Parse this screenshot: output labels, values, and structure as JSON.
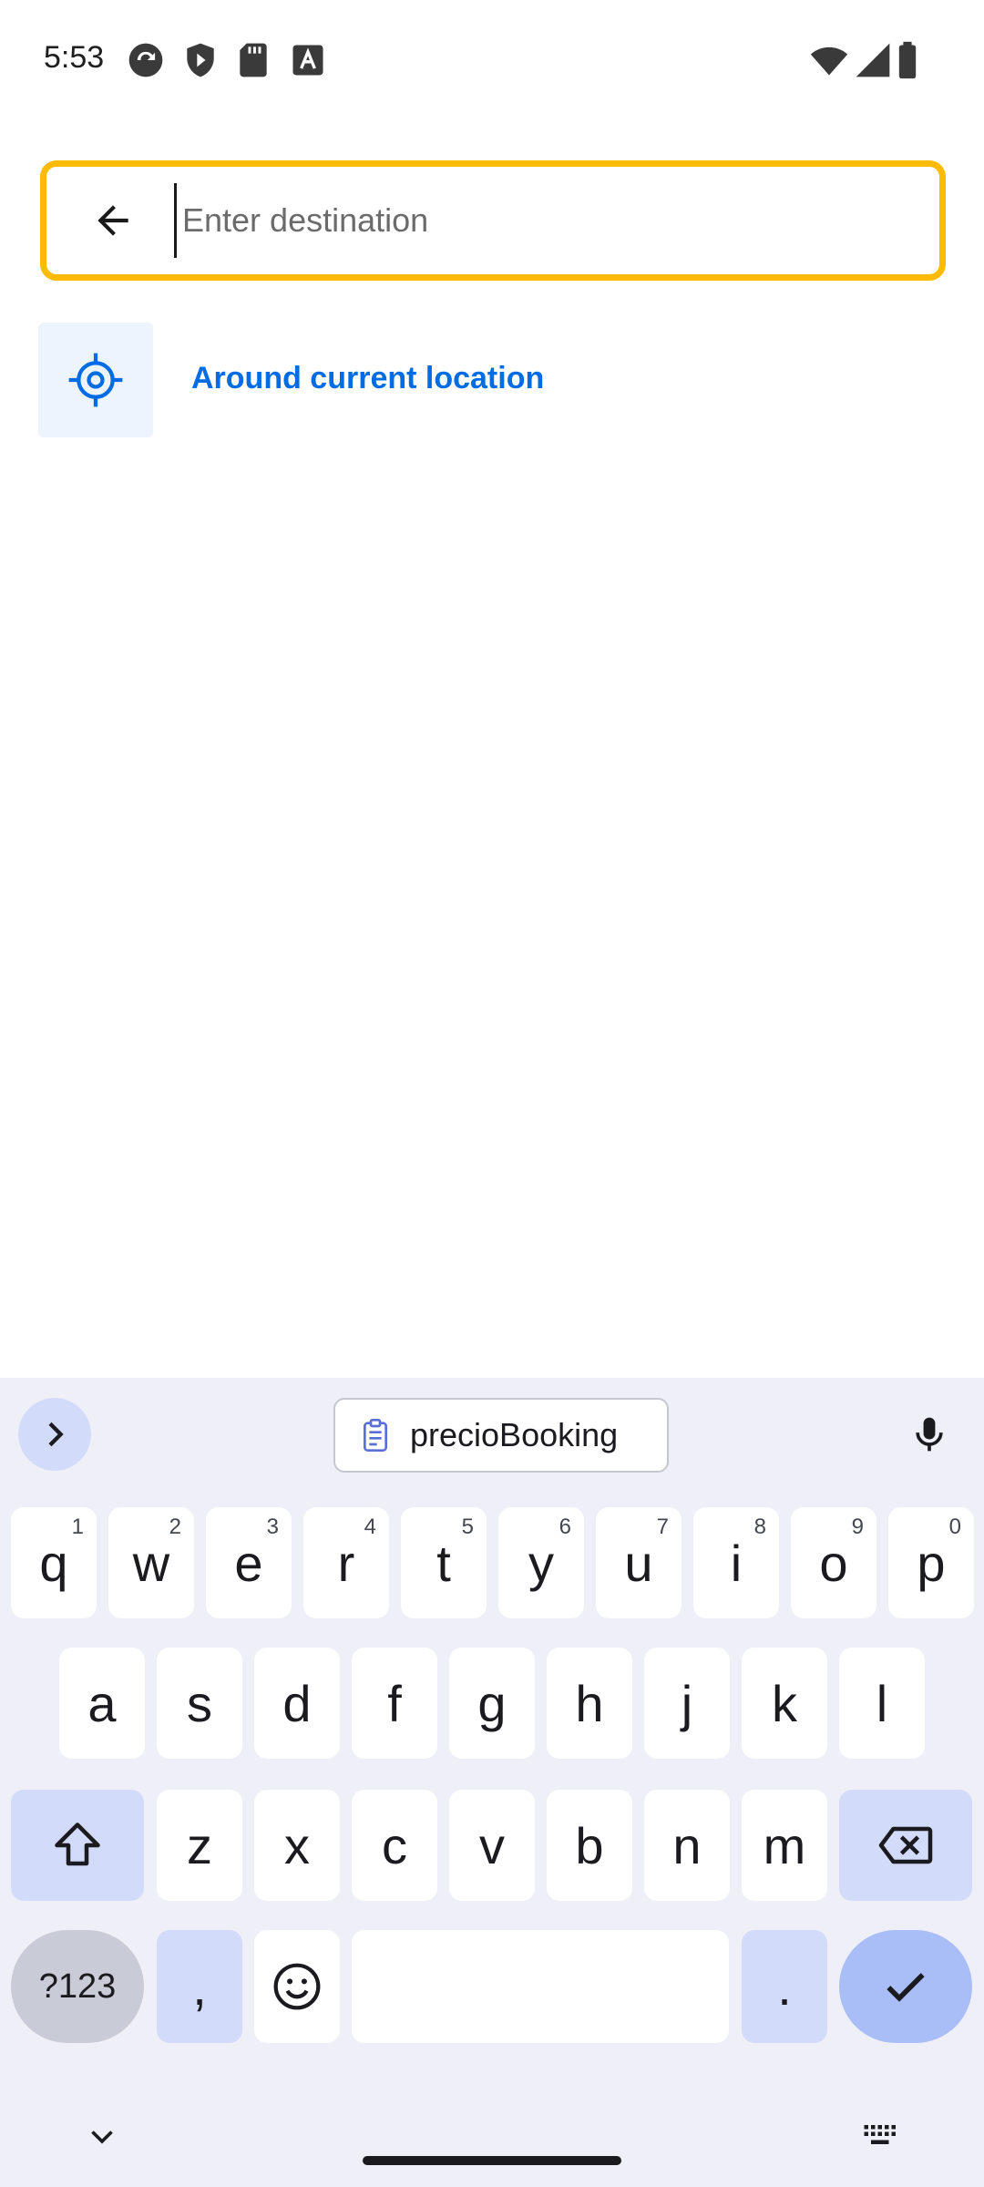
{
  "status_bar": {
    "time": "5:53",
    "left_icons": [
      "sync-icon",
      "shield-play-icon",
      "sd-card-icon",
      "font-a-icon"
    ],
    "right_icons": [
      "wifi-icon",
      "cellular-signal-icon",
      "battery-icon"
    ]
  },
  "search": {
    "placeholder": "Enter destination",
    "value": "",
    "back_icon": "arrow-left-icon",
    "border_color": "#febb02"
  },
  "suggestions": [
    {
      "label": "Around current location",
      "icon": "gps-crosshair-icon",
      "color": "#006ce4"
    }
  ],
  "keyboard": {
    "clipboard_suggestion": "precioBooking",
    "row1": [
      {
        "k": "q",
        "h": "1"
      },
      {
        "k": "w",
        "h": "2"
      },
      {
        "k": "e",
        "h": "3"
      },
      {
        "k": "r",
        "h": "4"
      },
      {
        "k": "t",
        "h": "5"
      },
      {
        "k": "y",
        "h": "6"
      },
      {
        "k": "u",
        "h": "7"
      },
      {
        "k": "i",
        "h": "8"
      },
      {
        "k": "o",
        "h": "9"
      },
      {
        "k": "p",
        "h": "0"
      }
    ],
    "row2": [
      "a",
      "s",
      "d",
      "f",
      "g",
      "h",
      "j",
      "k",
      "l"
    ],
    "row3": [
      "z",
      "x",
      "c",
      "v",
      "b",
      "n",
      "m"
    ],
    "symbols_label": "?123",
    "comma_label": ",",
    "period_label": ".",
    "space_label": ""
  }
}
